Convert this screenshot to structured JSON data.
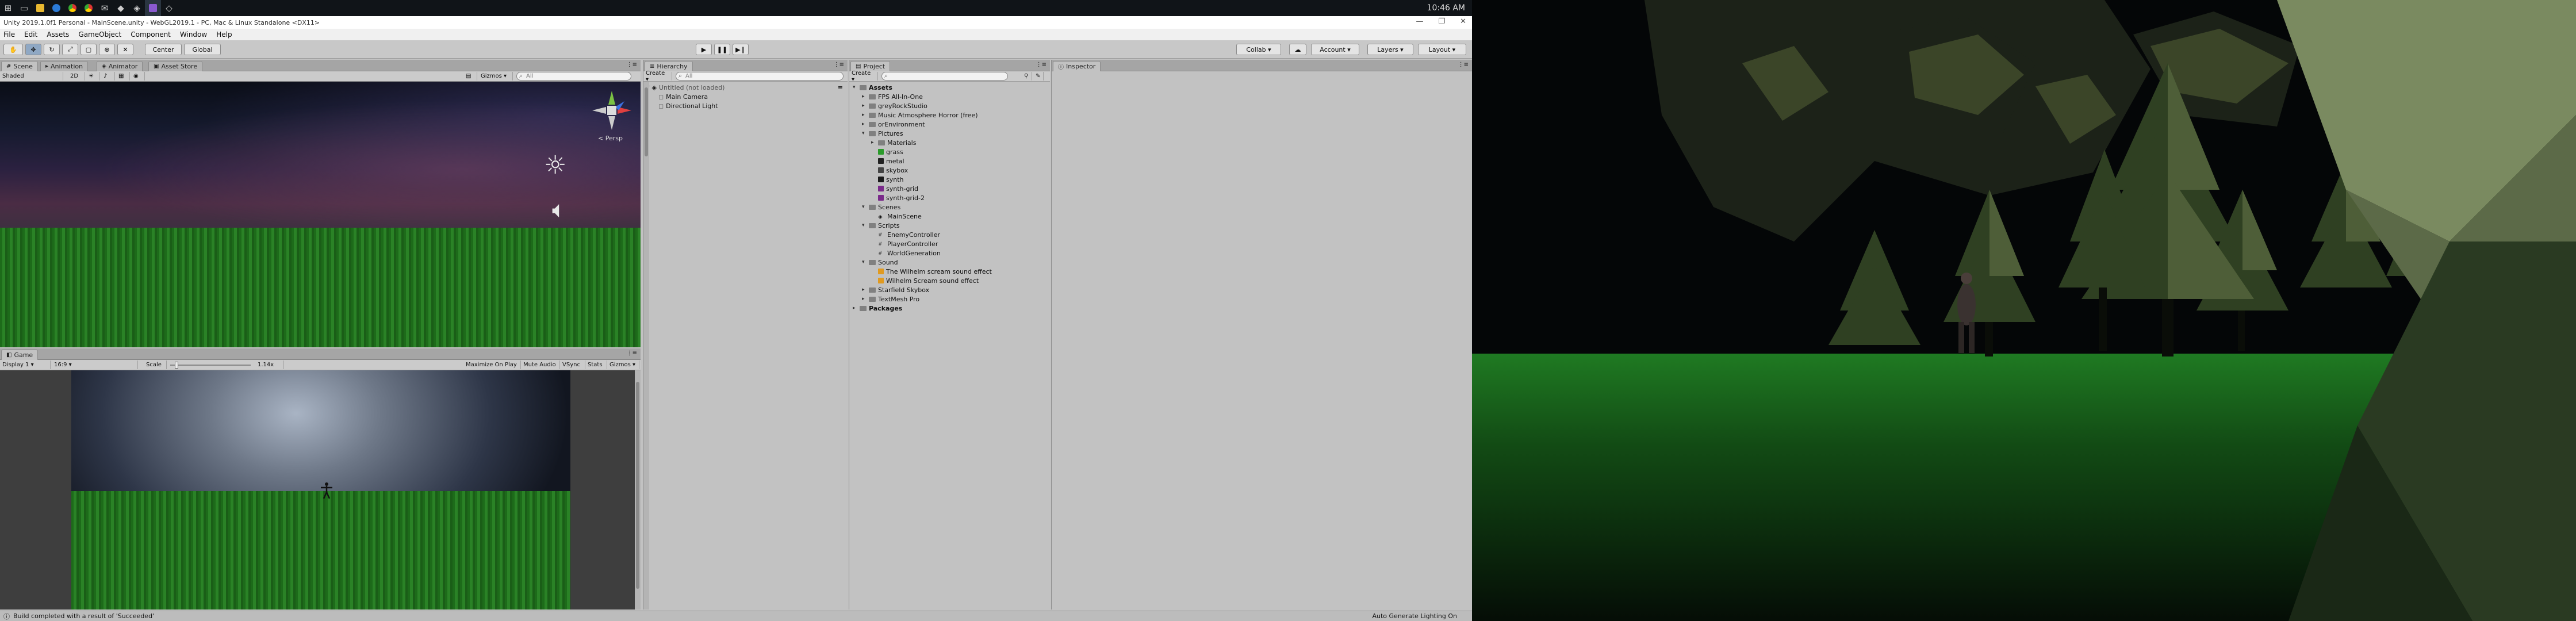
{
  "taskbar": {
    "icons": [
      "windows-start-icon",
      "task-view-icon",
      "file-explorer-icon",
      "edge-browser-icon",
      "chrome-icon",
      "chrome-icon",
      "mail-icon",
      "app-icon",
      "unity-icon",
      "visual-studio-icon",
      "unity-hub-icon"
    ],
    "clock": "10:46 AM"
  },
  "window": {
    "title": "Unity 2019.1.0f1 Personal - MainScene.unity - WebGL2019.1 - PC, Mac & Linux Standalone <DX11>"
  },
  "menu": [
    "File",
    "Edit",
    "Assets",
    "GameObject",
    "Component",
    "Window",
    "Help"
  ],
  "toolbar": {
    "pivot_label": "Center",
    "global_label": "Global",
    "collab_label": "Collab ▾",
    "account_label": "Account ▾",
    "layers_label": "Layers ▾",
    "layout_label": "Layout ▾"
  },
  "scene_panel": {
    "tabs": [
      "Scene",
      "Animation",
      "Animator",
      "Asset Store"
    ],
    "shading": "Shaded",
    "mode_2d": "2D",
    "gizmos_label": "Gizmos ▾",
    "search_placeholder": "All",
    "persp_label": "< Persp"
  },
  "game_panel": {
    "tab": "Game",
    "display": "Display 1",
    "aspect": "16:9",
    "scale_label": "Scale",
    "scale_value": "1.14x",
    "toggles": [
      "Maximize On Play",
      "Mute Audio",
      "VSync",
      "Stats",
      "Gizmos ▾"
    ]
  },
  "hierarchy": {
    "tab": "Hierarchy",
    "create_label": "Create ▾",
    "search_placeholder": "All",
    "scene_name": "Untitled (not loaded)",
    "items": [
      "Main Camera",
      "Directional Light"
    ]
  },
  "project": {
    "tab": "Project",
    "create_label": "Create ▾",
    "tree": [
      {
        "label": "Assets",
        "depth": 0,
        "open": true,
        "bold": true
      },
      {
        "label": "FPS All-In-One",
        "depth": 1
      },
      {
        "label": "greyRockStudio",
        "depth": 1
      },
      {
        "label": "Music Atmosphere Horror (free)",
        "depth": 1
      },
      {
        "label": "orEnvironment",
        "depth": 1
      },
      {
        "label": "Pictures",
        "depth": 1,
        "open": true
      },
      {
        "label": "Materials",
        "depth": 2
      },
      {
        "label": "grass",
        "depth": 2,
        "swatch": "#2a9a2a"
      },
      {
        "label": "metal",
        "depth": 2,
        "swatch": "#222222"
      },
      {
        "label": "skybox",
        "depth": 2,
        "swatch": "#444444"
      },
      {
        "label": "synth",
        "depth": 2,
        "swatch": "#1a1a1a"
      },
      {
        "label": "synth-grid",
        "depth": 2,
        "swatch": "#7a2a8a"
      },
      {
        "label": "synth-grid-2",
        "depth": 2,
        "swatch": "#7a2a8a"
      },
      {
        "label": "Scenes",
        "depth": 1,
        "open": true
      },
      {
        "label": "MainScene",
        "depth": 2,
        "scene": true
      },
      {
        "label": "Scripts",
        "depth": 1,
        "open": true
      },
      {
        "label": "EnemyController",
        "depth": 2,
        "script": true
      },
      {
        "label": "PlayerController",
        "depth": 2,
        "script": true
      },
      {
        "label": "WorldGeneration",
        "depth": 2,
        "script": true
      },
      {
        "label": "Sound",
        "depth": 1,
        "open": true
      },
      {
        "label": "The Wilhelm scream sound effect",
        "depth": 2,
        "swatch": "#e09a20"
      },
      {
        "label": "Wilhelm Scream sound effect",
        "depth": 2,
        "swatch": "#e09a20"
      },
      {
        "label": "Starfield Skybox",
        "depth": 1
      },
      {
        "label": "TextMesh Pro",
        "depth": 1
      },
      {
        "label": "Packages",
        "depth": 0,
        "bold": true
      }
    ]
  },
  "inspector": {
    "tab": "Inspector"
  },
  "status": {
    "message": "Build completed with a result of 'Succeeded'",
    "right": "Auto Generate Lighting On"
  },
  "colors": {
    "accent": "#8fa8c4",
    "grass": "#237a20"
  }
}
